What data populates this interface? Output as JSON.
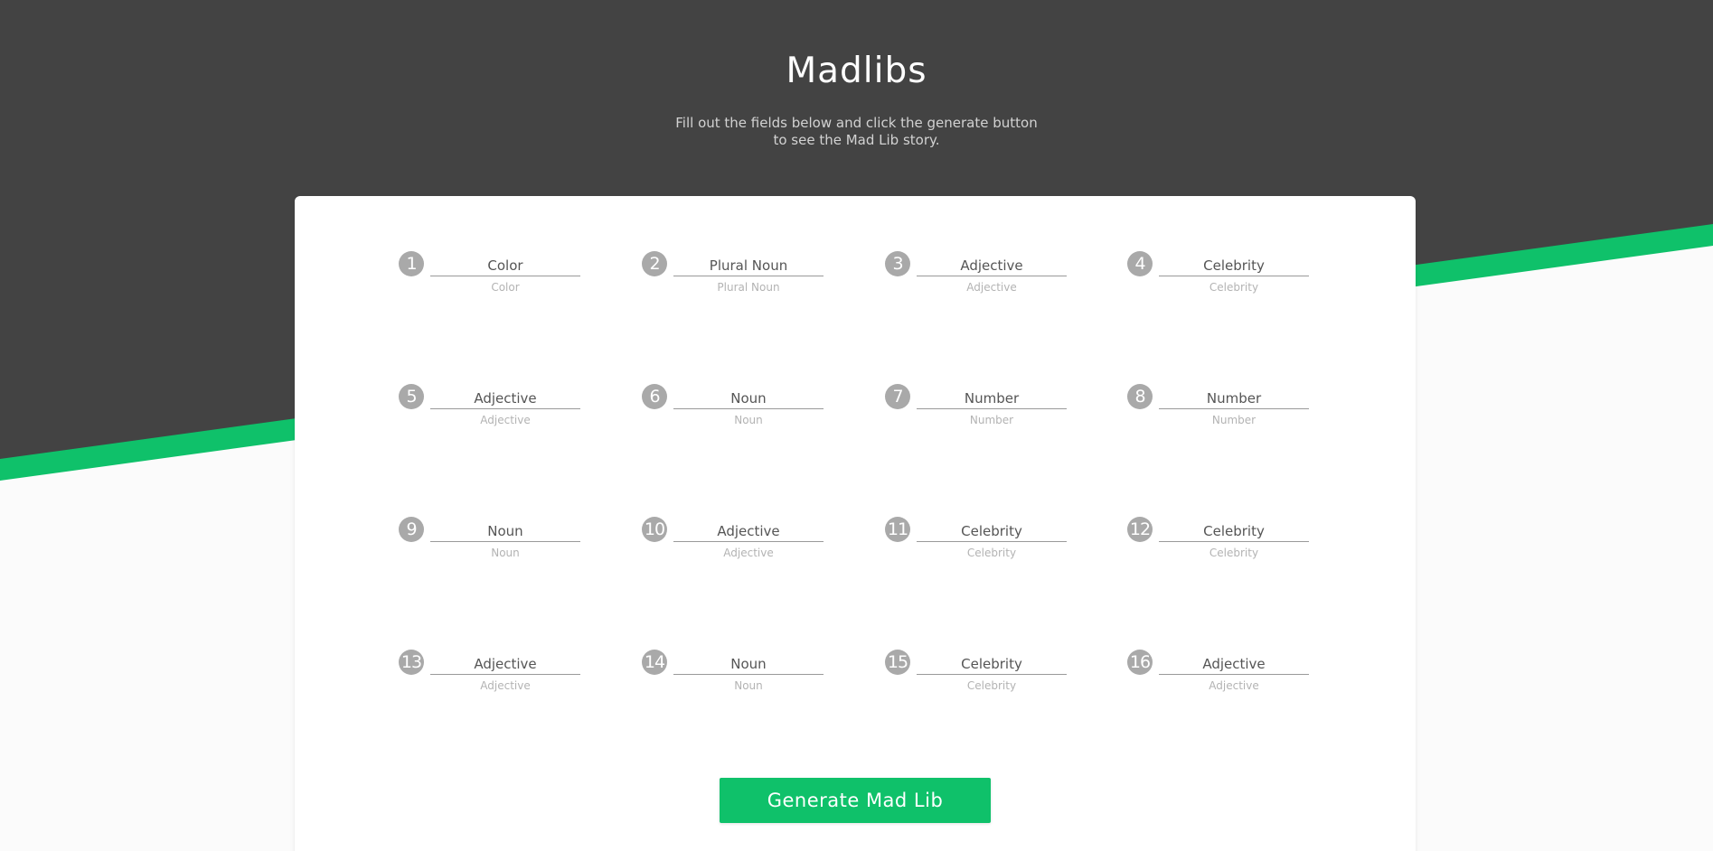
{
  "page": {
    "title": "Madlibs",
    "subtitle_line1": "Fill out the fields below and click the generate button",
    "subtitle_line2": "to see the Mad Lib story."
  },
  "colors": {
    "dark_bg": "#434343",
    "accent_green": "#0fc16a",
    "light_bg": "#fbfbfb",
    "badge_gray": "#a9a9a9"
  },
  "fields": [
    {
      "num": "1",
      "placeholder": "Color",
      "hint": "Color"
    },
    {
      "num": "2",
      "placeholder": "Plural Noun",
      "hint": "Plural Noun"
    },
    {
      "num": "3",
      "placeholder": "Adjective",
      "hint": "Adjective"
    },
    {
      "num": "4",
      "placeholder": "Celebrity",
      "hint": "Celebrity"
    },
    {
      "num": "5",
      "placeholder": "Adjective",
      "hint": "Adjective"
    },
    {
      "num": "6",
      "placeholder": "Noun",
      "hint": "Noun"
    },
    {
      "num": "7",
      "placeholder": "Number",
      "hint": "Number"
    },
    {
      "num": "8",
      "placeholder": "Number",
      "hint": "Number"
    },
    {
      "num": "9",
      "placeholder": "Noun",
      "hint": "Noun"
    },
    {
      "num": "10",
      "placeholder": "Adjective",
      "hint": "Adjective"
    },
    {
      "num": "11",
      "placeholder": "Celebrity",
      "hint": "Celebrity"
    },
    {
      "num": "12",
      "placeholder": "Celebrity",
      "hint": "Celebrity"
    },
    {
      "num": "13",
      "placeholder": "Adjective",
      "hint": "Adjective"
    },
    {
      "num": "14",
      "placeholder": "Noun",
      "hint": "Noun"
    },
    {
      "num": "15",
      "placeholder": "Celebrity",
      "hint": "Celebrity"
    },
    {
      "num": "16",
      "placeholder": "Adjective",
      "hint": "Adjective"
    }
  ],
  "button": {
    "label": "Generate Mad Lib"
  }
}
